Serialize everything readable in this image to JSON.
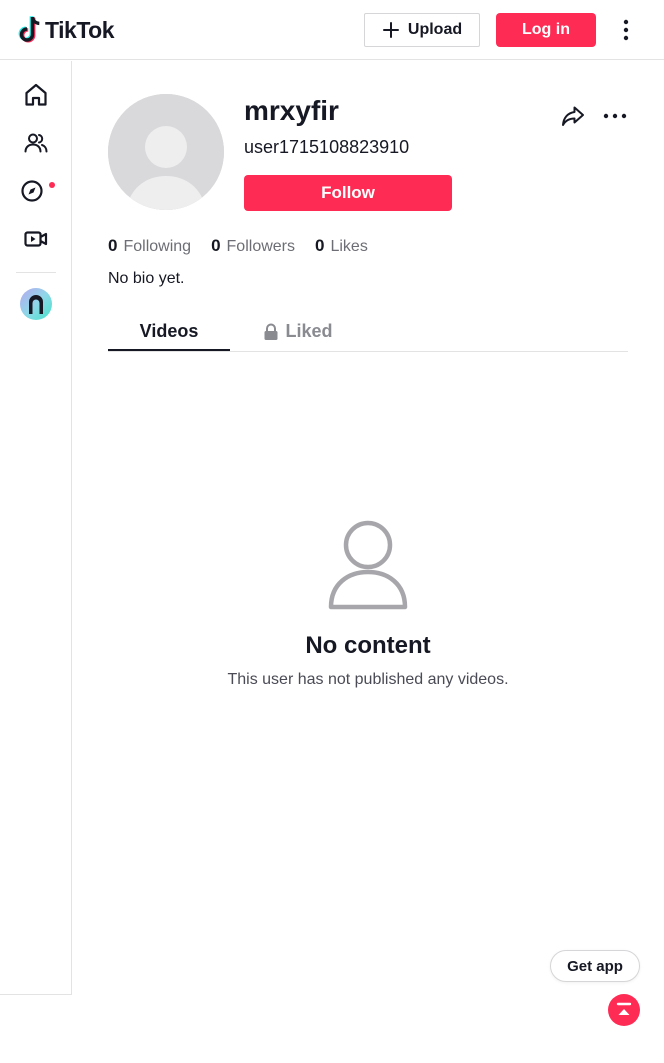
{
  "header": {
    "brand": "TikTok",
    "upload_label": "Upload",
    "login_label": "Log in"
  },
  "sidebar": {
    "items": [
      {
        "name": "home",
        "icon": "home-icon"
      },
      {
        "name": "following",
        "icon": "users-icon"
      },
      {
        "name": "explore",
        "icon": "compass-icon",
        "has_notification_dot": true
      },
      {
        "name": "live",
        "icon": "video-camera-icon"
      }
    ]
  },
  "profile": {
    "username": "mrxyfir",
    "handle": "user1715108823910",
    "follow_label": "Follow",
    "bio": "No bio yet.",
    "stats": [
      {
        "value": "0",
        "label": "Following"
      },
      {
        "value": "0",
        "label": "Followers"
      },
      {
        "value": "0",
        "label": "Likes"
      }
    ]
  },
  "tabs": [
    {
      "label": "Videos",
      "active": true
    },
    {
      "label": "Liked",
      "locked": true
    }
  ],
  "empty_state": {
    "title": "No content",
    "description": "This user has not published any videos."
  },
  "floating": {
    "get_app_label": "Get app"
  },
  "colors": {
    "accent": "#fe2c55",
    "text": "#161823",
    "muted": "#6d6e75",
    "border": "#e3e3e4"
  }
}
